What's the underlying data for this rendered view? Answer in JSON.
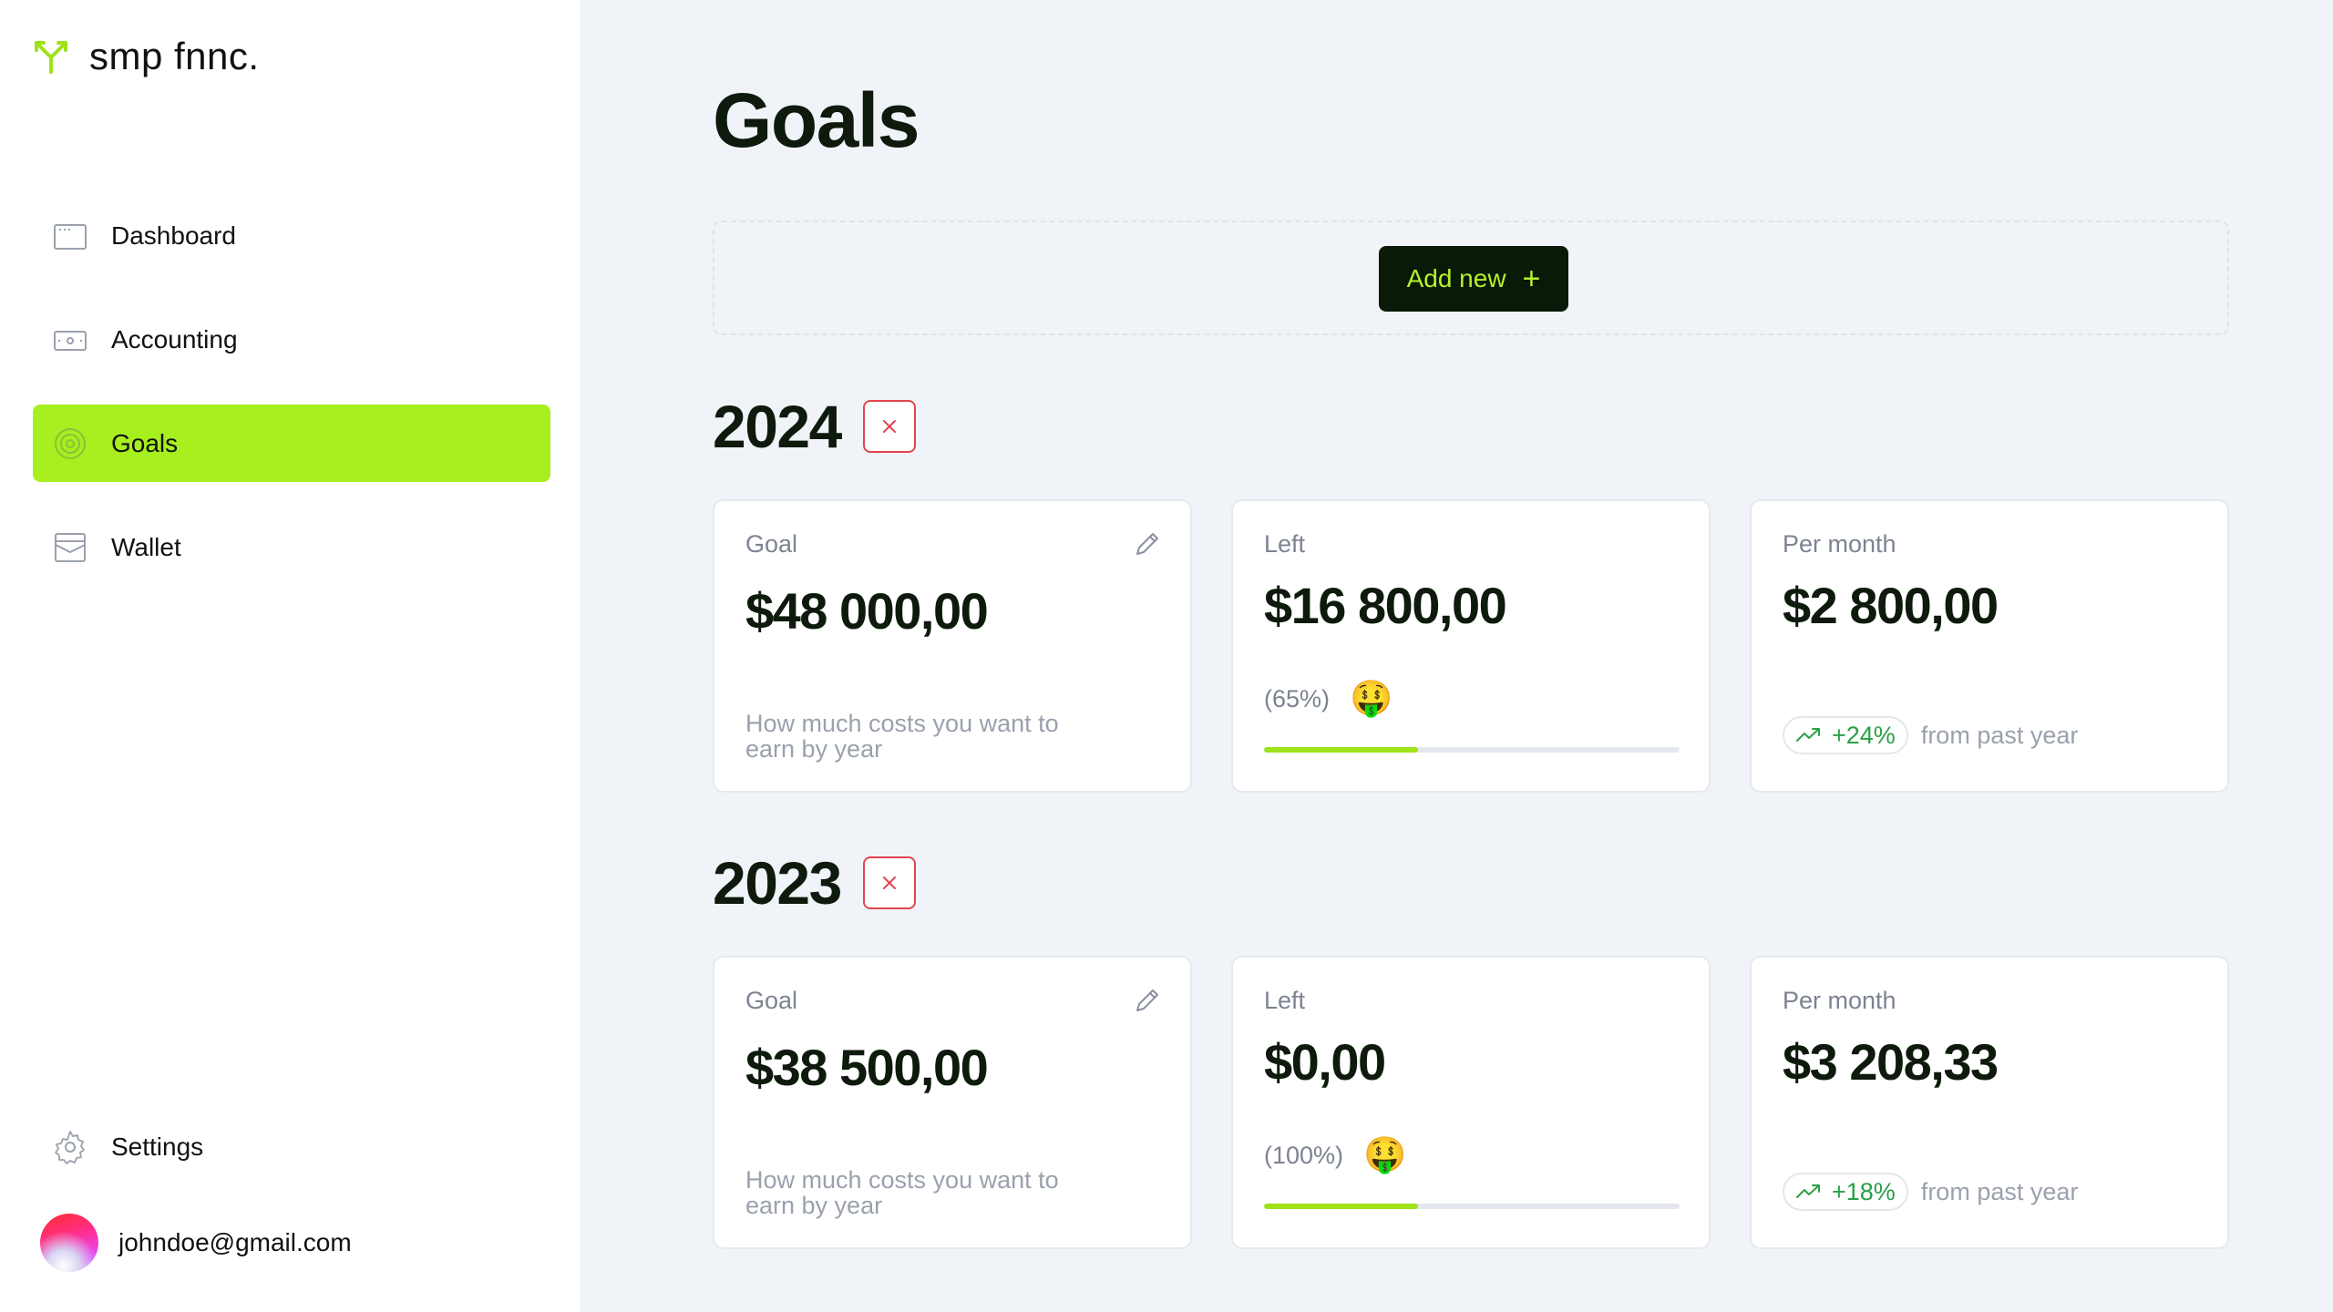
{
  "brand": {
    "name": "smp fnnc.",
    "accent": "#a8ef1f"
  },
  "sidebar": {
    "items": [
      {
        "label": "Dashboard",
        "icon": "dashboard-icon",
        "active": false
      },
      {
        "label": "Accounting",
        "icon": "banknote-icon",
        "active": false
      },
      {
        "label": "Goals",
        "icon": "target-icon",
        "active": true
      },
      {
        "label": "Wallet",
        "icon": "wallet-icon",
        "active": false
      }
    ],
    "settings_label": "Settings",
    "user_email": "johndoe@gmail.com"
  },
  "main": {
    "title": "Goals",
    "add_button_label": "Add new",
    "add_button_icon": "+",
    "years": [
      {
        "year": "2024",
        "goal": {
          "label": "Goal",
          "value": "$48 000,00",
          "description": "How much costs you want to earn by year"
        },
        "left": {
          "label": "Left",
          "value": "$16 800,00",
          "percent_text": "(65%)",
          "emoji": "🤑",
          "progress_fill": 0.37
        },
        "per_month": {
          "label": "Per month",
          "value": "$2 800,00",
          "trend": "+24%",
          "trend_text": "from past year"
        }
      },
      {
        "year": "2023",
        "goal": {
          "label": "Goal",
          "value": "$38 500,00",
          "description": "How much costs you want to earn by year"
        },
        "left": {
          "label": "Left",
          "value": "$0,00",
          "percent_text": "(100%)",
          "emoji": "🤑",
          "progress_fill": 0.37
        },
        "per_month": {
          "label": "Per month",
          "value": "$3 208,33",
          "trend": "+18%",
          "trend_text": "from past year"
        }
      }
    ]
  },
  "colors": {
    "trend_up": "#2aa046",
    "delete": "#e0464f",
    "dark_button": "#0b1a08"
  }
}
